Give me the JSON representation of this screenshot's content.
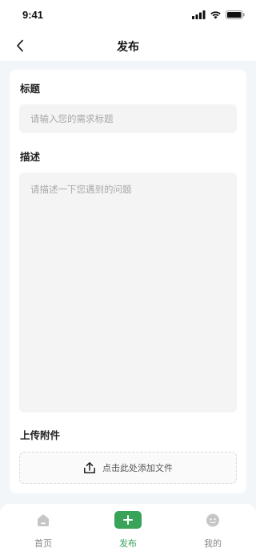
{
  "status_bar": {
    "time": "9:41"
  },
  "nav": {
    "title": "发布"
  },
  "form": {
    "title_label": "标题",
    "title_placeholder": "请输入您的需求标题",
    "desc_label": "描述",
    "desc_placeholder": "请描述一下您遇到的问题",
    "attach_label": "上传附件",
    "upload_text": "点击此处添加文件"
  },
  "tabbar": {
    "items": [
      {
        "label": "首页",
        "icon": "home-icon"
      },
      {
        "label": "发布",
        "icon": "plus-icon"
      },
      {
        "label": "我的",
        "icon": "profile-icon"
      }
    ],
    "active_index": 1
  },
  "colors": {
    "accent": "#3aa35a",
    "background": "#f3f6f9",
    "input_bg": "#f4f4f5"
  }
}
